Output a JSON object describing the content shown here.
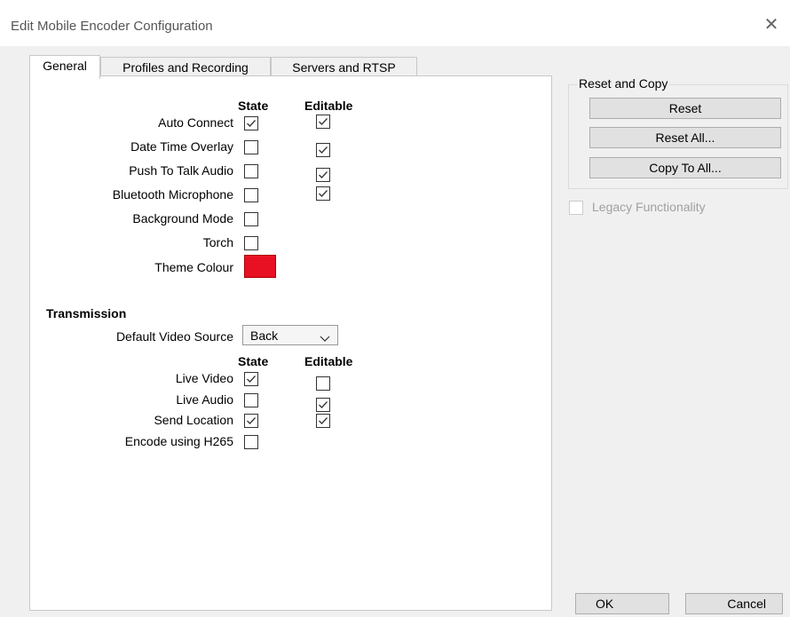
{
  "window": {
    "title": "Edit Mobile Encoder Configuration"
  },
  "tabs": [
    {
      "label": "General"
    },
    {
      "label": "Profiles and Recording"
    },
    {
      "label": "Servers and RTSP"
    }
  ],
  "general": {
    "headers": {
      "state": "State",
      "editable": "Editable"
    },
    "rows": [
      {
        "label": "Auto Connect",
        "state": true,
        "editable": true
      },
      {
        "label": "Date Time Overlay",
        "state": false,
        "editable": true
      },
      {
        "label": "Push To Talk Audio",
        "state": false,
        "editable": true
      },
      {
        "label": "Bluetooth Microphone",
        "state": false,
        "editable": true
      },
      {
        "label": "Background Mode",
        "state": false,
        "editable": null
      },
      {
        "label": "Torch",
        "state": false,
        "editable": null
      }
    ],
    "theme_colour": {
      "label": "Theme Colour",
      "color": "#e81123"
    }
  },
  "transmission": {
    "title": "Transmission",
    "default_video_source": {
      "label": "Default Video Source",
      "value": "Back"
    },
    "headers": {
      "state": "State",
      "editable": "Editable"
    },
    "rows": [
      {
        "label": "Live Video",
        "state": true,
        "editable": false
      },
      {
        "label": "Live Audio",
        "state": false,
        "editable": true
      },
      {
        "label": "Send Location",
        "state": true,
        "editable": true
      },
      {
        "label": "Encode using H265",
        "state": false,
        "editable": null
      }
    ]
  },
  "reset_group": {
    "title": "Reset and Copy",
    "reset_label": "Reset",
    "reset_all_label": "Reset All...",
    "copy_to_all_label": "Copy To All..."
  },
  "legacy": {
    "label": "Legacy Functionality",
    "checked": false,
    "enabled": false
  },
  "footer": {
    "ok_label": "OK",
    "cancel_label": "Cancel"
  }
}
